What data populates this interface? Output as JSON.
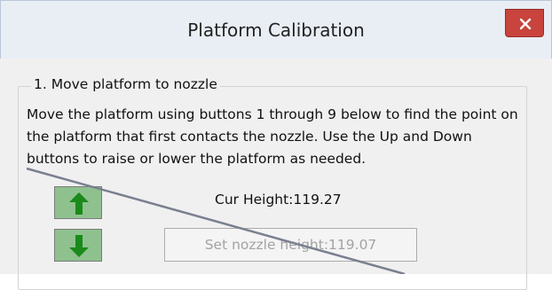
{
  "window": {
    "title": "Platform Calibration",
    "close_symbol": "✕"
  },
  "section": {
    "legend": "1. Move platform to nozzle",
    "description": "Move the platform using buttons 1 through 9 below to find the point on the platform that first contacts the nozzle. Use the Up and Down buttons to raise or lower the platform as needed."
  },
  "controls": {
    "up_icon": "up-arrow-icon",
    "down_icon": "down-arrow-icon",
    "cur_height": "Cur Height:119.27",
    "set_button": "Set nozzle height:119.07"
  },
  "colors": {
    "arrow_fill": "#1a8a1a",
    "arrow_button_bg": "#8fc18f",
    "close_bg": "#c8443c",
    "disabled_text": "#a3a3a3"
  }
}
